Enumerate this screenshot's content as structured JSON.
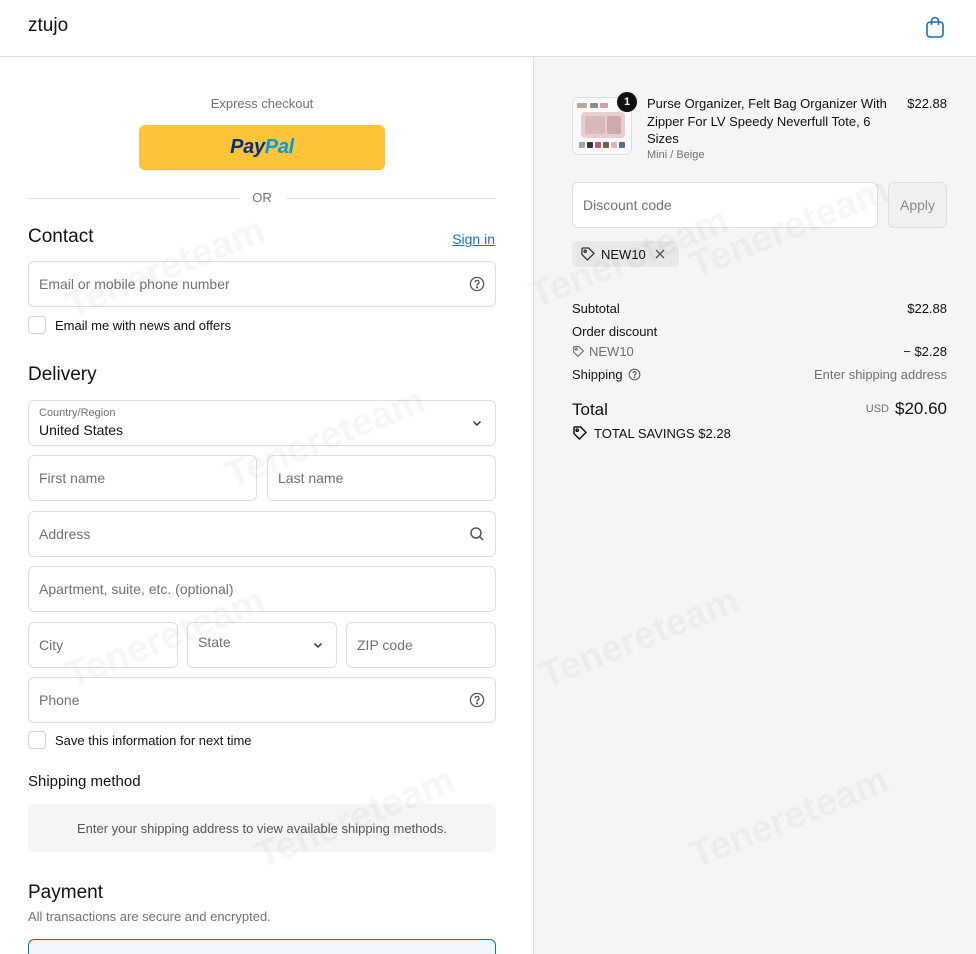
{
  "header": {
    "brand": "ztujo",
    "cart_icon": "shopping-bag-icon"
  },
  "express": {
    "label": "Express checkout",
    "paypal_part1": "Pay",
    "paypal_part2": "Pal",
    "or_label": "OR"
  },
  "contact": {
    "title": "Contact",
    "sign_in": "Sign in",
    "email_placeholder": "Email or mobile phone number",
    "newsletter_label": "Email me with news and offers"
  },
  "delivery": {
    "title": "Delivery",
    "country_label": "Country/Region",
    "country_value": "United States",
    "first_name": "First name",
    "last_name": "Last name",
    "address": "Address",
    "apartment": "Apartment, suite, etc. (optional)",
    "city": "City",
    "state": "State",
    "zip": "ZIP code",
    "phone": "Phone",
    "save_label": "Save this information for next time"
  },
  "shipping": {
    "title": "Shipping method",
    "message": "Enter your shipping address to view available shipping methods."
  },
  "payment": {
    "title": "Payment",
    "subtitle": "All transactions are secure and encrypted."
  },
  "order": {
    "item": {
      "quantity": "1",
      "title": "Purse Organizer, Felt Bag Organizer With Zipper For LV Speedy Neverfull Tote, 6 Sizes",
      "variant": "Mini / Beige",
      "price": "$22.88"
    },
    "discount_placeholder": "Discount code",
    "apply_label": "Apply",
    "applied_code": "NEW10",
    "subtotal_label": "Subtotal",
    "subtotal_value": "$22.88",
    "order_discount_label": "Order discount",
    "discount_code": "NEW10",
    "discount_value": "− $2.28",
    "shipping_label": "Shipping",
    "shipping_value": "Enter shipping address",
    "total_label": "Total",
    "currency": "USD",
    "total_value": "$20.60",
    "savings_label": "TOTAL SAVINGS",
    "savings_value": "$2.28"
  },
  "watermark": "Tenereteam",
  "colors": {
    "paypal_yellow": "#ffc439",
    "link_blue": "#1773b0",
    "summary_bg": "#f5f5f5"
  }
}
